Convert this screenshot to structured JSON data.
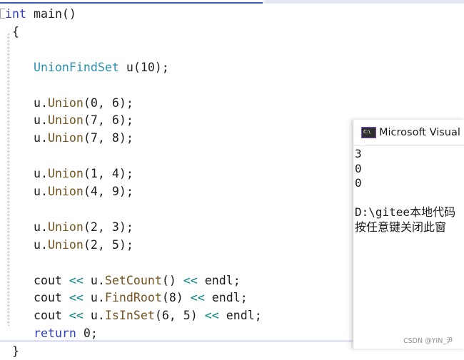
{
  "editor": {
    "lines": [
      [
        {
          "c": "kw",
          "t": "int"
        },
        {
          "c": "id",
          "t": " main()"
        }
      ],
      [
        {
          "c": "id",
          "t": " {"
        }
      ],
      [
        {
          "c": "id",
          "t": ""
        }
      ],
      [
        {
          "c": "id",
          "t": "    "
        },
        {
          "c": "ty",
          "t": "UnionFindSet"
        },
        {
          "c": "id",
          "t": " u(10);"
        }
      ],
      [
        {
          "c": "id",
          "t": ""
        }
      ],
      [
        {
          "c": "id",
          "t": "    u."
        },
        {
          "c": "fn",
          "t": "Union"
        },
        {
          "c": "id",
          "t": "(0, 6);"
        }
      ],
      [
        {
          "c": "id",
          "t": "    u."
        },
        {
          "c": "fn",
          "t": "Union"
        },
        {
          "c": "id",
          "t": "(7, 6);"
        }
      ],
      [
        {
          "c": "id",
          "t": "    u."
        },
        {
          "c": "fn",
          "t": "Union"
        },
        {
          "c": "id",
          "t": "(7, 8);"
        }
      ],
      [
        {
          "c": "id",
          "t": ""
        }
      ],
      [
        {
          "c": "id",
          "t": "    u."
        },
        {
          "c": "fn",
          "t": "Union"
        },
        {
          "c": "id",
          "t": "(1, 4);"
        }
      ],
      [
        {
          "c": "id",
          "t": "    u."
        },
        {
          "c": "fn",
          "t": "Union"
        },
        {
          "c": "id",
          "t": "(4, 9);"
        }
      ],
      [
        {
          "c": "id",
          "t": ""
        }
      ],
      [
        {
          "c": "id",
          "t": "    u."
        },
        {
          "c": "fn",
          "t": "Union"
        },
        {
          "c": "id",
          "t": "(2, 3);"
        }
      ],
      [
        {
          "c": "id",
          "t": "    u."
        },
        {
          "c": "fn",
          "t": "Union"
        },
        {
          "c": "id",
          "t": "(2, 5);"
        }
      ],
      [
        {
          "c": "id",
          "t": ""
        }
      ],
      [
        {
          "c": "id",
          "t": "    cout "
        },
        {
          "c": "op",
          "t": "<<"
        },
        {
          "c": "id",
          "t": " u."
        },
        {
          "c": "fn",
          "t": "SetCount"
        },
        {
          "c": "id",
          "t": "() "
        },
        {
          "c": "op",
          "t": "<<"
        },
        {
          "c": "id",
          "t": " endl;"
        }
      ],
      [
        {
          "c": "id",
          "t": "    cout "
        },
        {
          "c": "op",
          "t": "<<"
        },
        {
          "c": "id",
          "t": " u."
        },
        {
          "c": "fn",
          "t": "FindRoot"
        },
        {
          "c": "id",
          "t": "(8) "
        },
        {
          "c": "op",
          "t": "<<"
        },
        {
          "c": "id",
          "t": " endl;"
        }
      ],
      [
        {
          "c": "id",
          "t": "    cout "
        },
        {
          "c": "op",
          "t": "<<"
        },
        {
          "c": "id",
          "t": " u."
        },
        {
          "c": "fn",
          "t": "IsInSet"
        },
        {
          "c": "id",
          "t": "(6, 5) "
        },
        {
          "c": "op",
          "t": "<<"
        },
        {
          "c": "id",
          "t": " endl;"
        }
      ],
      [
        {
          "c": "id",
          "t": "    "
        },
        {
          "c": "kw",
          "t": "return"
        },
        {
          "c": "id",
          "t": " 0;"
        }
      ],
      [
        {
          "c": "id",
          "t": " }"
        }
      ]
    ]
  },
  "console": {
    "icon": "console-app-icon",
    "icon_text": "C:\\",
    "title": "Microsoft Visual",
    "output": [
      "3",
      "0",
      "0",
      "",
      "D:\\gitee本地代码",
      "按任意键关闭此窗"
    ]
  },
  "watermark": "CSDN @YIN_尹",
  "colors": {
    "keyword": "#2f3fbf",
    "type": "#2b91af",
    "function": "#74531f",
    "operator": "#008080",
    "text": "#1e1e1e"
  }
}
